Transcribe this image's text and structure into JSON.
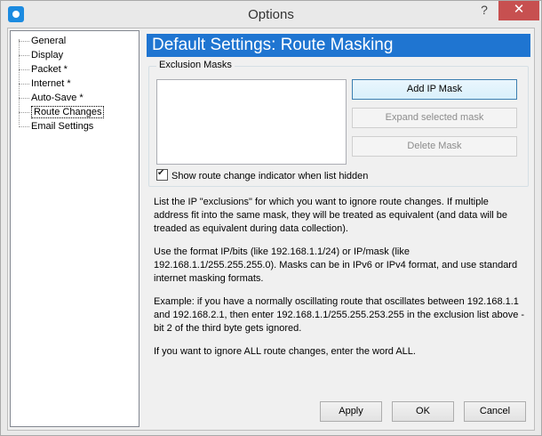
{
  "window": {
    "title": "Options",
    "help_glyph": "?",
    "close_glyph": "✕"
  },
  "tree": {
    "items": [
      {
        "label": "General"
      },
      {
        "label": "Display"
      },
      {
        "label": "Packet *"
      },
      {
        "label": "Internet *"
      },
      {
        "label": "Auto-Save *"
      },
      {
        "label": "Route Changes",
        "selected": true
      },
      {
        "label": "Email Settings"
      }
    ]
  },
  "panel": {
    "header": "Default Settings: Route Masking",
    "group_label": "Exclusion Masks",
    "buttons": {
      "add": "Add IP Mask",
      "expand": "Expand selected mask",
      "delete": "Delete Mask"
    },
    "checkbox": {
      "label": "Show route change indicator when list hidden",
      "checked": true
    },
    "description": [
      "List the IP \"exclusions\" for which you want to ignore route changes. If multiple address fit into the same mask, they will be treated as equivalent (and data will be treaded as equivalent during data collection).",
      "Use the format IP/bits (like 192.168.1.1/24) or IP/mask (like 192.168.1.1/255.255.255.0). Masks can be in IPv6 or IPv4 format, and use standard internet masking formats.",
      "Example: if you have a normally oscillating route that oscillates between 192.168.1.1 and 192.168.2.1, then enter 192.168.1.1/255.255.253.255 in the exclusion list above - bit 2 of the third byte gets ignored.",
      "If you want to ignore ALL route changes, enter the word ALL."
    ]
  },
  "footer": {
    "apply": "Apply",
    "ok": "OK",
    "cancel": "Cancel"
  },
  "colors": {
    "header_bg": "#1f75d1",
    "close_bg": "#c75050"
  }
}
